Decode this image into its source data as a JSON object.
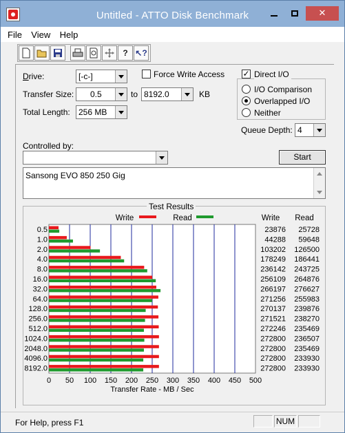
{
  "window": {
    "title": "Untitled - ATTO Disk Benchmark"
  },
  "menu": {
    "items": [
      "File",
      "View",
      "Help"
    ]
  },
  "toolbar": {
    "icons": [
      "new-icon",
      "open-icon",
      "save-icon",
      "print-icon",
      "print-preview-icon",
      "move-icon",
      "help-icon",
      "context-help-icon"
    ]
  },
  "drive": {
    "label": "Drive:",
    "value": "[-c-]"
  },
  "force_write": {
    "label": "Force Write Access",
    "checked": false
  },
  "direct_io": {
    "label": "Direct I/O",
    "checked": true
  },
  "transfer_size": {
    "label": "Transfer Size:",
    "from": "0.5",
    "to_label": "to",
    "to": "8192.0",
    "unit": "KB"
  },
  "total_length": {
    "label": "Total Length:",
    "value": "256 MB"
  },
  "io_mode": {
    "options": [
      "I/O Comparison",
      "Overlapped I/O",
      "Neither"
    ],
    "selected": "Overlapped I/O"
  },
  "queue_depth": {
    "label": "Queue Depth:",
    "value": "4"
  },
  "controlled_by": {
    "label": "Controlled by:",
    "value": ""
  },
  "start_button": {
    "label": "Start"
  },
  "description": {
    "text": "Sansong EVO 850 250 Gig"
  },
  "results": {
    "title": "Test Results",
    "write_legend": "Write",
    "read_legend": "Read",
    "write_header": "Write",
    "read_header": "Read"
  },
  "chart_data": {
    "type": "bar",
    "title": "Test Results",
    "xlabel": "Transfer Rate - MB / Sec",
    "xlim": [
      0,
      500
    ],
    "xticks": [
      "0",
      "50",
      "100",
      "150",
      "200",
      "250",
      "300",
      "350",
      "400",
      "450",
      "500"
    ],
    "grid": true,
    "legend": "top-center",
    "categories": [
      "0.5",
      "1.0",
      "2.0",
      "4.0",
      "8.0",
      "16.0",
      "32.0",
      "64.0",
      "128.0",
      "256.0",
      "512.0",
      "1024.0",
      "2048.0",
      "4096.0",
      "8192.0"
    ],
    "series": [
      {
        "name": "Write",
        "color": "#e8191d",
        "values": [
          23876,
          44288,
          103202,
          178249,
          236142,
          256109,
          266197,
          271256,
          270137,
          271521,
          272246,
          272800,
          272800,
          272800,
          272800
        ]
      },
      {
        "name": "Read",
        "color": "#1f9a2e",
        "values": [
          25728,
          59648,
          126500,
          186441,
          243725,
          264876,
          276627,
          255983,
          239876,
          238270,
          235469,
          236507,
          235469,
          233930,
          233930
        ]
      }
    ]
  },
  "status": {
    "text": "For Help, press F1",
    "num": "NUM"
  }
}
